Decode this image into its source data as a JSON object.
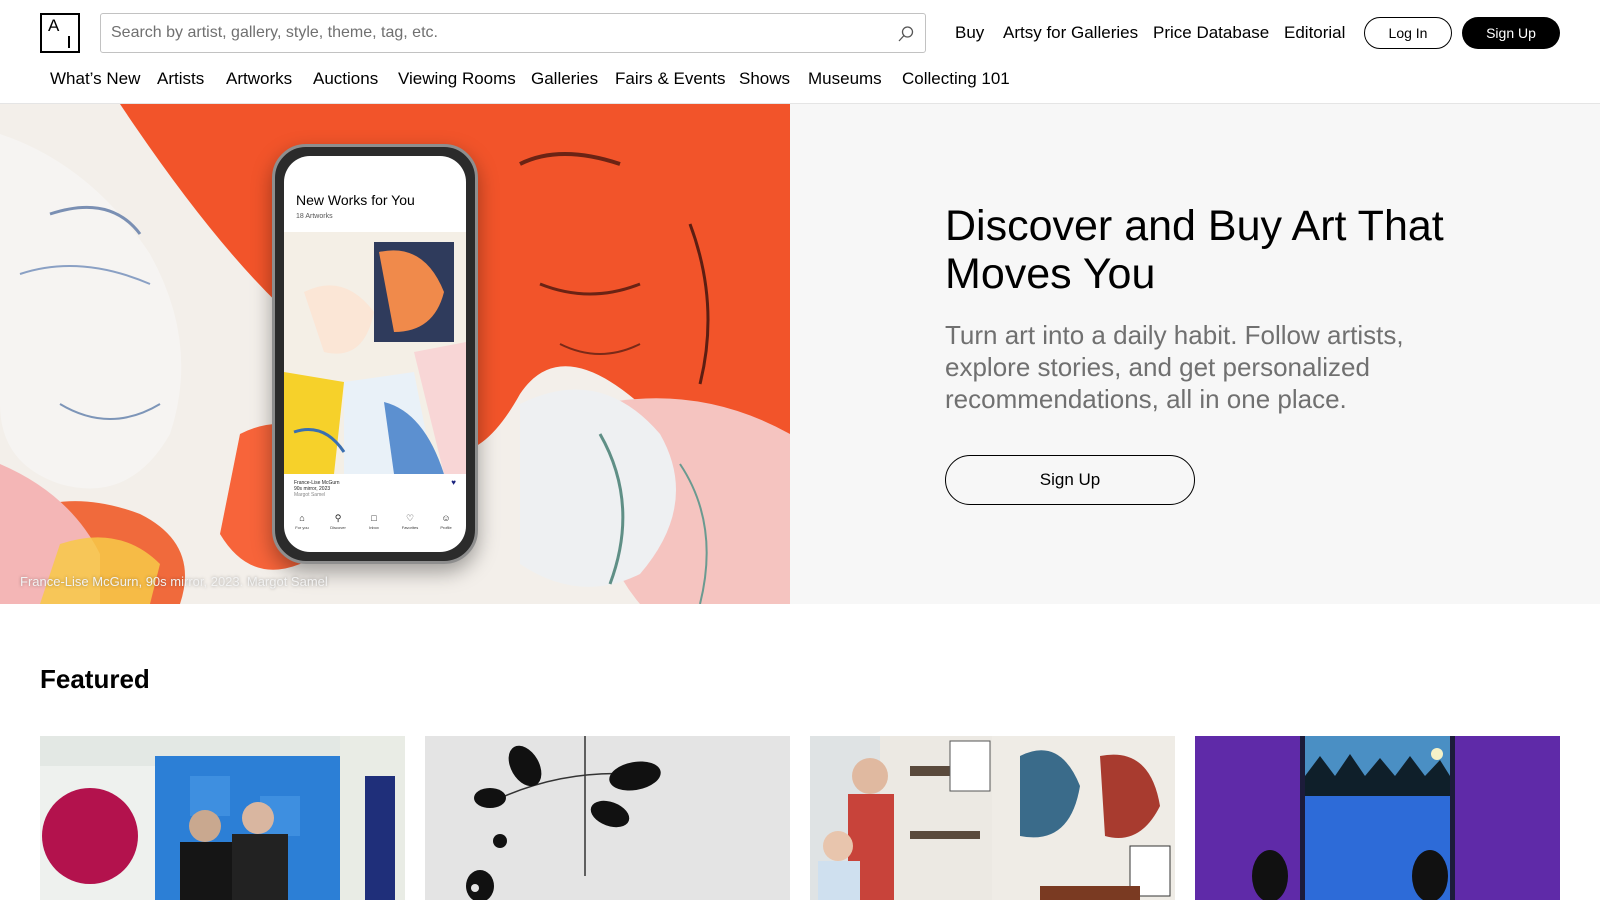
{
  "header": {
    "logo_label": "A",
    "search": {
      "placeholder": "Search by artist, gallery, style, theme, tag, etc.",
      "value": ""
    },
    "top_links": [
      "Buy",
      "Artsy for Galleries",
      "Price Database",
      "Editorial"
    ],
    "login_label": "Log In",
    "signup_label": "Sign Up"
  },
  "subnav": {
    "items": [
      "What’s New",
      "Artists",
      "Artworks",
      "Auctions",
      "Viewing Rooms",
      "Galleries",
      "Fairs & Events",
      "Shows",
      "Museums",
      "Collecting 101"
    ]
  },
  "hero": {
    "image_caption": "France-Lise McGurn, 90s mirror, 2023. Margot Samel",
    "phone": {
      "title": "New Works for You",
      "count": "18 Artworks",
      "artwork_artist": "France-Lise McGurn",
      "artwork_title": "90s mirror, 2023",
      "artwork_gallery": "Margot Samel",
      "tabs": [
        "For you",
        "Discover",
        "Inbox",
        "Favorites",
        "Profile"
      ]
    },
    "title": "Discover and Buy Art That Moves You",
    "subtitle": "Turn art into a daily habit. Follow artists, explore stories, and get personalized recommendations, all in one place.",
    "cta_label": "Sign Up"
  },
  "featured": {
    "title": "Featured"
  },
  "colors": {
    "accent": "#000000",
    "hero_bg": "#f7f7f7",
    "muted_text": "#707070",
    "hero_orange": "#f2542a"
  },
  "icons": {
    "search": "search-icon",
    "logo": "artsy-logo-icon"
  }
}
